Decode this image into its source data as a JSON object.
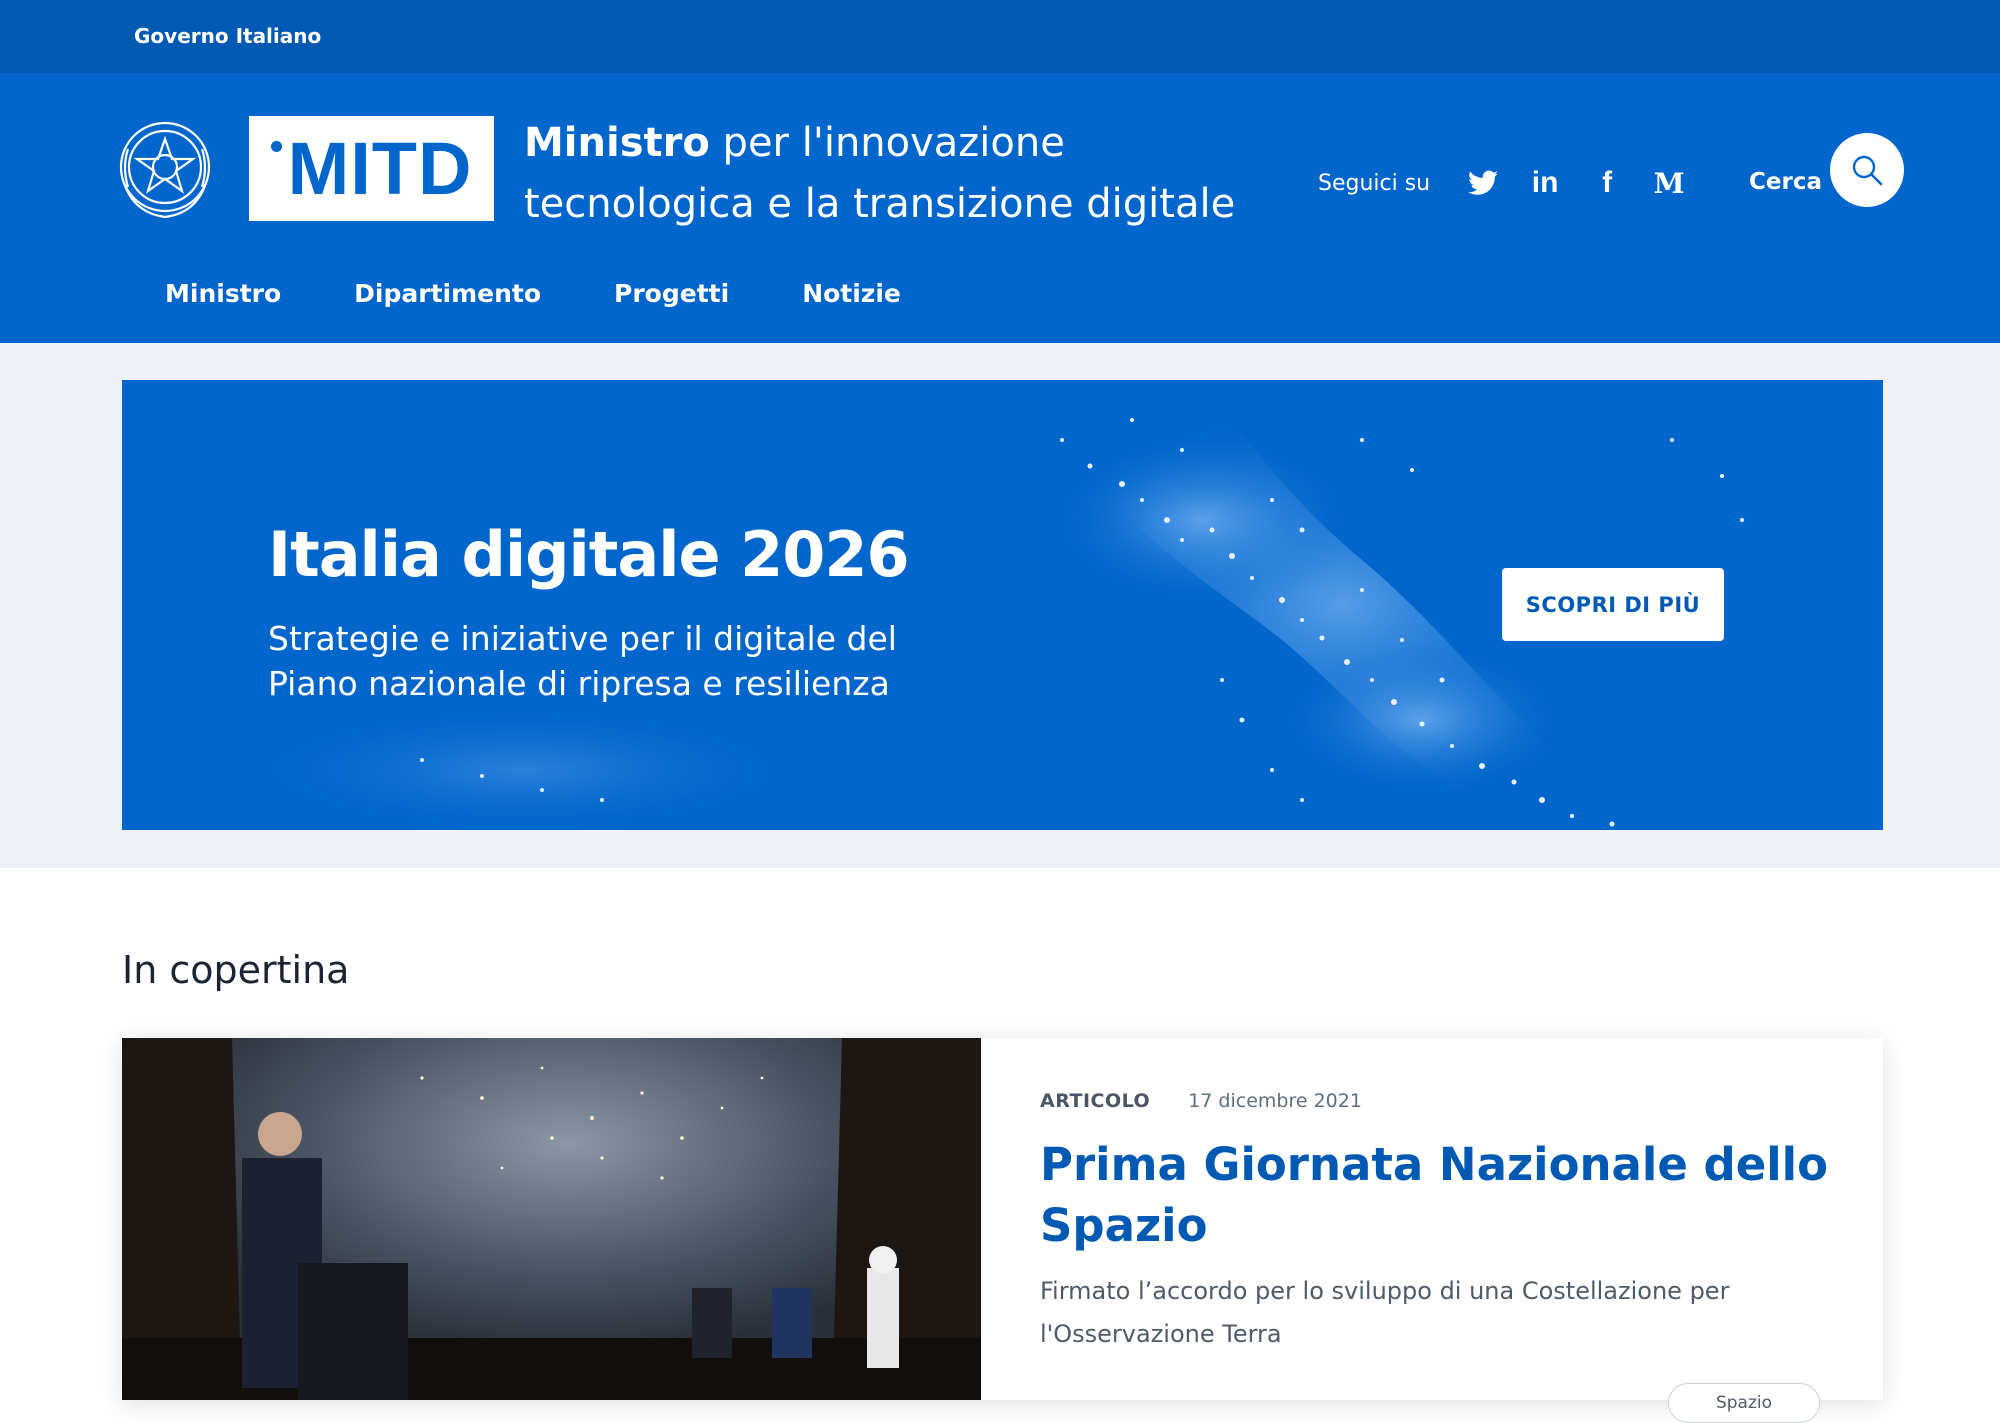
{
  "gov_bar": {
    "label": "Governo Italiano"
  },
  "header": {
    "logo_text": "MITD",
    "title_bold": "Ministro",
    "title_rest": " per l'innovazione tecnologica e la transizione digitale",
    "follow_label": "Seguici su",
    "social_icons": [
      "twitter-icon",
      "linkedin-icon",
      "facebook-icon",
      "medium-icon"
    ],
    "linkedin_glyph": "in",
    "facebook_glyph": "f",
    "medium_glyph": "M",
    "search_label": "Cerca"
  },
  "nav": {
    "items": [
      "Ministro",
      "Dipartimento",
      "Progetti",
      "Notizie"
    ]
  },
  "hero": {
    "title": "Italia digitale 2026",
    "subtitle": "Strategie e iniziative per il digitale del Piano nazionale di ripresa e resilienza",
    "cta_label": "SCOPRI DI PIÙ"
  },
  "featured": {
    "section_title": "In copertina",
    "card": {
      "category": "ARTICOLO",
      "date": "17 dicembre 2021",
      "title": "Prima Giornata Nazionale dello Spazio",
      "description": "Firmato l’accordo per lo sviluppo di una Costellazione per l'Osservazione Terra",
      "tag": "Spazio"
    }
  },
  "colors": {
    "gov_bar": "#0059b3",
    "header": "#0066cc",
    "hero_bg": "#0066cc",
    "link": "#0059b3",
    "section_bg": "#eef2f7"
  }
}
